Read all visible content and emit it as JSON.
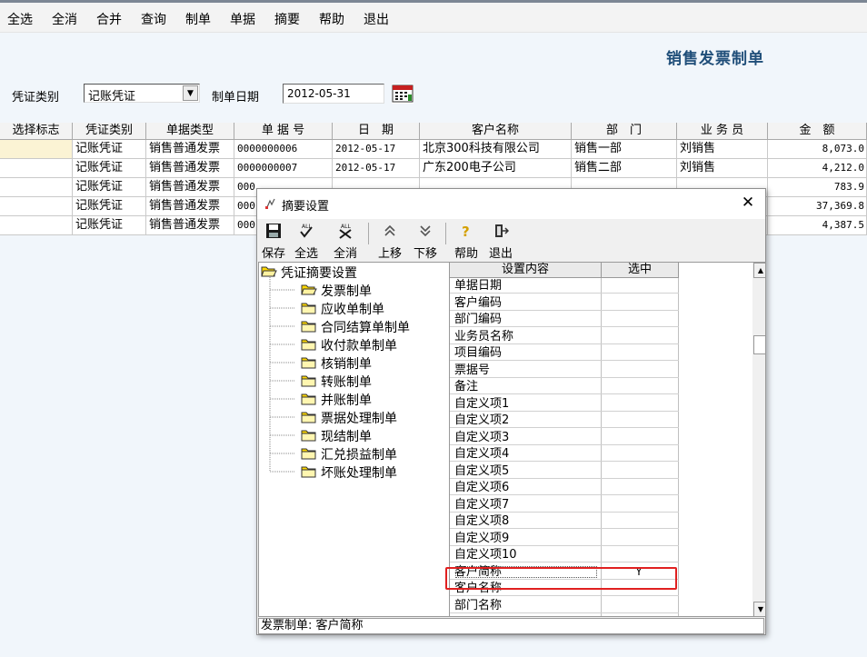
{
  "menu": [
    "全选",
    "全消",
    "合并",
    "查询",
    "制单",
    "单据",
    "摘要",
    "帮助",
    "退出"
  ],
  "page_title": "销售发票制单",
  "filter": {
    "voucher_type_label": "凭证类别",
    "voucher_type_value": "记账凭证",
    "date_label": "制单日期",
    "date_value": "2012-05-31"
  },
  "table": {
    "headers": [
      "选择标志",
      "凭证类别",
      "单据类型",
      "单 据 号",
      "日　期",
      "客户名称",
      "部　门",
      "业 务 员",
      "金　额"
    ],
    "rows": [
      {
        "voucher": "记账凭证",
        "bill_type": "销售普通发票",
        "bill_no": "0000000006",
        "date": "2012-05-17",
        "customer": "北京300科技有限公司",
        "dept": "销售一部",
        "salesman": "刘销售",
        "amount": "8,073.0"
      },
      {
        "voucher": "记账凭证",
        "bill_type": "销售普通发票",
        "bill_no": "0000000007",
        "date": "2012-05-17",
        "customer": "广东200电子公司",
        "dept": "销售二部",
        "salesman": "刘销售",
        "amount": "4,212.0"
      },
      {
        "voucher": "记账凭证",
        "bill_type": "销售普通发票",
        "bill_no": "000",
        "date": "",
        "customer": "",
        "dept": "",
        "salesman": "",
        "amount": "783.9"
      },
      {
        "voucher": "记账凭证",
        "bill_type": "销售普通发票",
        "bill_no": "000",
        "date": "",
        "customer": "",
        "dept": "",
        "salesman": "",
        "amount": "37,369.8"
      },
      {
        "voucher": "记账凭证",
        "bill_type": "销售普通发票",
        "bill_no": "000",
        "date": "",
        "customer": "",
        "dept": "",
        "salesman": "",
        "amount": "4,387.5"
      }
    ]
  },
  "dialog": {
    "title": "摘要设置",
    "toolbar": [
      "保存",
      "全选",
      "全消",
      "上移",
      "下移",
      "帮助",
      "退出"
    ],
    "tree": {
      "root": "凭证摘要设置",
      "items": [
        "发票制单",
        "应收单制单",
        "合同结算单制单",
        "收付款单制单",
        "核销制单",
        "转账制单",
        "并账制单",
        "票据处理制单",
        "现结制单",
        "汇兑损益制单",
        "坏账处理制单"
      ]
    },
    "grid": {
      "headers": [
        "设置内容",
        "选中"
      ],
      "rows": [
        {
          "name": "单据日期",
          "sel": ""
        },
        {
          "name": "客户编码",
          "sel": ""
        },
        {
          "name": "部门编码",
          "sel": ""
        },
        {
          "name": "业务员名称",
          "sel": ""
        },
        {
          "name": "项目编码",
          "sel": ""
        },
        {
          "name": "票据号",
          "sel": ""
        },
        {
          "name": "备注",
          "sel": ""
        },
        {
          "name": "自定义项1",
          "sel": ""
        },
        {
          "name": "自定义项2",
          "sel": ""
        },
        {
          "name": "自定义项3",
          "sel": ""
        },
        {
          "name": "自定义项4",
          "sel": ""
        },
        {
          "name": "自定义项5",
          "sel": ""
        },
        {
          "name": "自定义项6",
          "sel": ""
        },
        {
          "name": "自定义项7",
          "sel": ""
        },
        {
          "name": "自定义项8",
          "sel": ""
        },
        {
          "name": "自定义项9",
          "sel": ""
        },
        {
          "name": "自定义项10",
          "sel": ""
        },
        {
          "name": "客户简称",
          "sel": "Y"
        },
        {
          "name": "客户名称",
          "sel": ""
        },
        {
          "name": "部门名称",
          "sel": ""
        }
      ]
    },
    "status": "发票制单: 客户简称"
  },
  "colors": {
    "title": "#1f4e79",
    "highlight": "#e02020",
    "selected_cell": "#fbf3d4",
    "folder": "#ffd800"
  }
}
